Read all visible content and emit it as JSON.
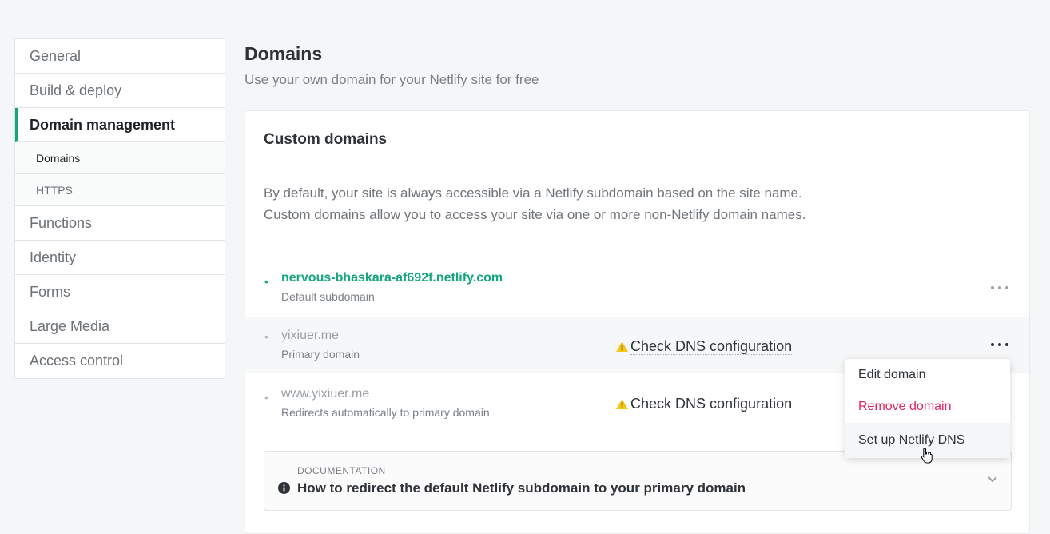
{
  "sidebar": {
    "items": [
      {
        "label": "General"
      },
      {
        "label": "Build & deploy"
      },
      {
        "label": "Domain management"
      },
      {
        "label": "Functions"
      },
      {
        "label": "Identity"
      },
      {
        "label": "Forms"
      },
      {
        "label": "Large Media"
      },
      {
        "label": "Access control"
      }
    ],
    "subitems": [
      {
        "label": "Domains"
      },
      {
        "label": "HTTPS"
      }
    ]
  },
  "header": {
    "title": "Domains",
    "subtitle": "Use your own domain for your Netlify site for free"
  },
  "card": {
    "title": "Custom domains",
    "description": "By default, your site is always accessible via a Netlify subdomain based on the site name. Custom domains allow you to access your site via one or more non-Netlify domain names.",
    "domains": [
      {
        "name": "nervous-bhaskara-af692f.netlify.com",
        "note": "Default subdomain"
      },
      {
        "name": "yixiuer.me",
        "note": "Primary domain",
        "status": "Check DNS configuration"
      },
      {
        "name": "www.yixiuer.me",
        "note": "Redirects automatically to primary domain",
        "status": "Check DNS configuration"
      }
    ]
  },
  "menu": {
    "items": [
      {
        "label": "Edit domain"
      },
      {
        "label": "Remove domain"
      },
      {
        "label": "Set up Netlify DNS"
      }
    ]
  },
  "documentation": {
    "label": "DOCUMENTATION",
    "title": "How to redirect the default Netlify subdomain to your primary domain"
  },
  "colors": {
    "accent": "#15a57f",
    "danger": "#e5245b",
    "warning": "#f5c518"
  }
}
